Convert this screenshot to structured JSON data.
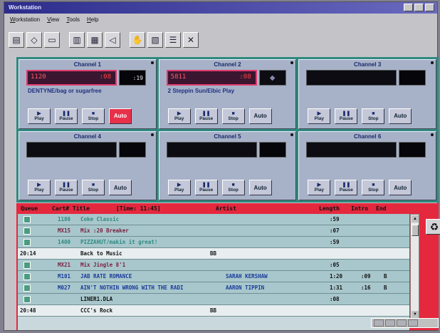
{
  "window": {
    "title": "Workstation"
  },
  "menubar": {
    "items": [
      {
        "label": "Workstation"
      },
      {
        "label": "View"
      },
      {
        "label": "Tools"
      },
      {
        "label": "Help"
      }
    ]
  },
  "toolbar": {
    "tools": [
      {
        "icon": "document-icon",
        "glyph": "▤"
      },
      {
        "icon": "cart-icon",
        "glyph": "◇"
      },
      {
        "icon": "panel-icon",
        "glyph": "▭"
      },
      {
        "icon": "equalizer-icon",
        "glyph": "▥"
      },
      {
        "icon": "meter-icon",
        "glyph": "▦"
      },
      {
        "icon": "speaker-icon",
        "glyph": "◁"
      },
      {
        "icon": "hand-icon",
        "glyph": "✋"
      },
      {
        "icon": "library-icon",
        "glyph": "▧"
      },
      {
        "icon": "list-icon",
        "glyph": "☰"
      },
      {
        "icon": "tools-icon",
        "glyph": "✕"
      }
    ]
  },
  "channels": [
    {
      "title": "Channel 1",
      "cue_left": "1120",
      "cue_right": ":08",
      "timer": ":19",
      "track": "DENTYNE/bag or sugarfree",
      "active": true,
      "buttons": {
        "play": "Play",
        "pause": "Pause",
        "stop": "Stop",
        "auto": "Auto"
      }
    },
    {
      "title": "Channel 2",
      "cue_left": "5811",
      "cue_right": ":08",
      "timer": "",
      "track": "2 Steppin Sun/Elbic Play",
      "active": false,
      "buttons": {
        "play": "Play",
        "pause": "Pause",
        "stop": "Stop",
        "auto": "Auto"
      }
    },
    {
      "title": "Channel 3",
      "cue_left": "",
      "cue_right": "",
      "timer": "",
      "track": "",
      "active": false,
      "buttons": {
        "play": "Play",
        "pause": "Pause",
        "stop": "Stop",
        "auto": "Auto"
      }
    },
    {
      "title": "Channel 4",
      "cue_left": "",
      "cue_right": "",
      "timer": "",
      "track": "",
      "active": false,
      "buttons": {
        "play": "Play",
        "pause": "Pause",
        "stop": "Stop",
        "auto": "Auto"
      }
    },
    {
      "title": "Channel 5",
      "cue_left": "",
      "cue_right": "",
      "timer": "",
      "track": "",
      "active": false,
      "buttons": {
        "play": "Play",
        "pause": "Pause",
        "stop": "Stop",
        "auto": "Auto"
      }
    },
    {
      "title": "Channel 6",
      "cue_left": "",
      "cue_right": "",
      "timer": "",
      "track": "",
      "active": false,
      "buttons": {
        "play": "Play",
        "pause": "Pause",
        "stop": "Stop",
        "auto": "Auto"
      }
    }
  ],
  "queue": {
    "headers": {
      "queue": "Queue",
      "cart_title": "Cart# Title",
      "time": "[Time:  11:45]",
      "artist": "Artist",
      "length": "Length",
      "intro": "Intro",
      "end": "End"
    },
    "rows": [
      {
        "type": "cart",
        "time": "",
        "cart": "1100",
        "title": "Coke Classic",
        "artist": "",
        "length": ":59",
        "intro": "",
        "end": "",
        "color": "#2d8a82"
      },
      {
        "type": "cart",
        "time": "",
        "cart": "MX15",
        "title": "Mix :20 Breaker",
        "artist": "",
        "length": ":07",
        "intro": "",
        "end": "",
        "color": "#7a2040"
      },
      {
        "type": "cart",
        "time": "",
        "cart": "1400",
        "title": "PIZZAHUT/makin it great!",
        "artist": "",
        "length": ":59",
        "intro": "",
        "end": "",
        "color": "#2d8a82"
      },
      {
        "type": "marker",
        "time": "20:14",
        "cart": "",
        "title": "Back to Music",
        "artist": "",
        "length": "",
        "intro": "",
        "end": "",
        "code": "BB",
        "color": "#111111"
      },
      {
        "type": "cart",
        "time": "",
        "cart": "MX21",
        "title": "Mix Jingle 8'1",
        "artist": "",
        "length": ":05",
        "intro": "",
        "end": "",
        "color": "#7a2040"
      },
      {
        "type": "cart",
        "time": "",
        "cart": "M101",
        "title": "JAB RATE ROMANCE",
        "artist": "SARAH KERSHAW",
        "length": "1:20",
        "intro": ":09",
        "end": "B",
        "color": "#1a3a9a"
      },
      {
        "type": "cart",
        "time": "",
        "cart": "M027",
        "title": "AIN'T NOTHIN WRONG WITH THE RADI",
        "artist": "AARON TIPPIN",
        "length": "1:31",
        "intro": ":16",
        "end": "B",
        "color": "#1a3a9a"
      },
      {
        "type": "cart",
        "time": "",
        "cart": "",
        "title": "LINER1.DLA",
        "artist": "",
        "length": ":08",
        "intro": "",
        "end": "",
        "color": "#111111"
      },
      {
        "type": "marker",
        "time": "20:48",
        "cart": "",
        "title": "CCC's Rock",
        "artist": "",
        "length": "",
        "intro": "",
        "end": "",
        "code": "BB",
        "color": "#111111"
      }
    ]
  },
  "side_tools": {
    "recycle_icon": "recycle-icon"
  },
  "colors": {
    "channel_bg": "#2e8a7e",
    "queue_bg": "#e4283e",
    "auto_active": "#e8304a"
  }
}
